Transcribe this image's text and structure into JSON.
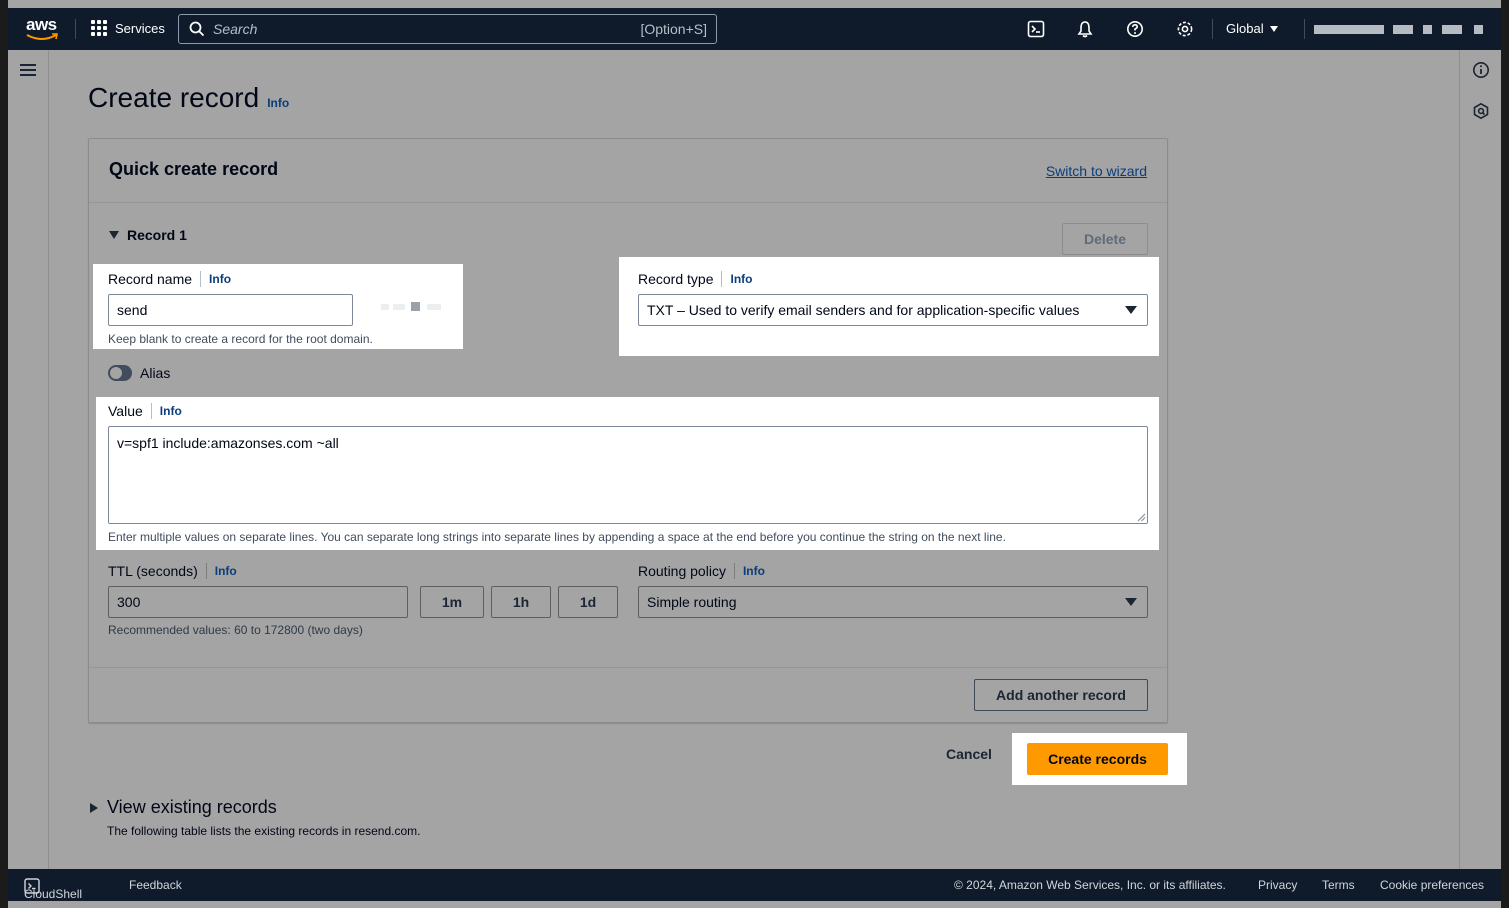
{
  "topnav": {
    "logo_text": "aws",
    "services_label": "Services",
    "search_placeholder": "Search",
    "search_shortcut": "[Option+S]",
    "region_label": "Global",
    "icons": [
      "cloudshell-icon",
      "bell-icon",
      "help-icon",
      "gear-icon"
    ]
  },
  "page": {
    "title": "Create record",
    "info": "Info"
  },
  "panel": {
    "title": "Quick create record",
    "switch_link": "Switch to wizard",
    "record_label": "Record 1",
    "delete_label": "Delete"
  },
  "record_name": {
    "label": "Record name",
    "info": "Info",
    "value": "send",
    "helper": "Keep blank to create a record for the root domain."
  },
  "record_type": {
    "label": "Record type",
    "info": "Info",
    "value": "TXT – Used to verify email senders and for application-specific values"
  },
  "alias": {
    "label": "Alias"
  },
  "value_field": {
    "label": "Value",
    "info": "Info",
    "value": "v=spf1 include:amazonses.com ~all",
    "helper": "Enter multiple values on separate lines. You can separate long strings into separate lines by appending a space at the end before you continue the string on the next line."
  },
  "ttl": {
    "label": "TTL (seconds)",
    "info": "Info",
    "value": "300",
    "buttons": [
      "1m",
      "1h",
      "1d"
    ],
    "helper": "Recommended values: 60 to 172800 (two days)"
  },
  "routing": {
    "label": "Routing policy",
    "info": "Info",
    "value": "Simple routing"
  },
  "actions": {
    "add_another": "Add another record",
    "cancel": "Cancel",
    "create": "Create records"
  },
  "existing": {
    "title": "View existing records",
    "description": "The following table lists the existing records in resend.com."
  },
  "footer": {
    "cloudshell": "CloudShell",
    "feedback": "Feedback",
    "copyright": "© 2024, Amazon Web Services, Inc. or its affiliates.",
    "privacy": "Privacy",
    "terms": "Terms",
    "cookies": "Cookie preferences"
  }
}
